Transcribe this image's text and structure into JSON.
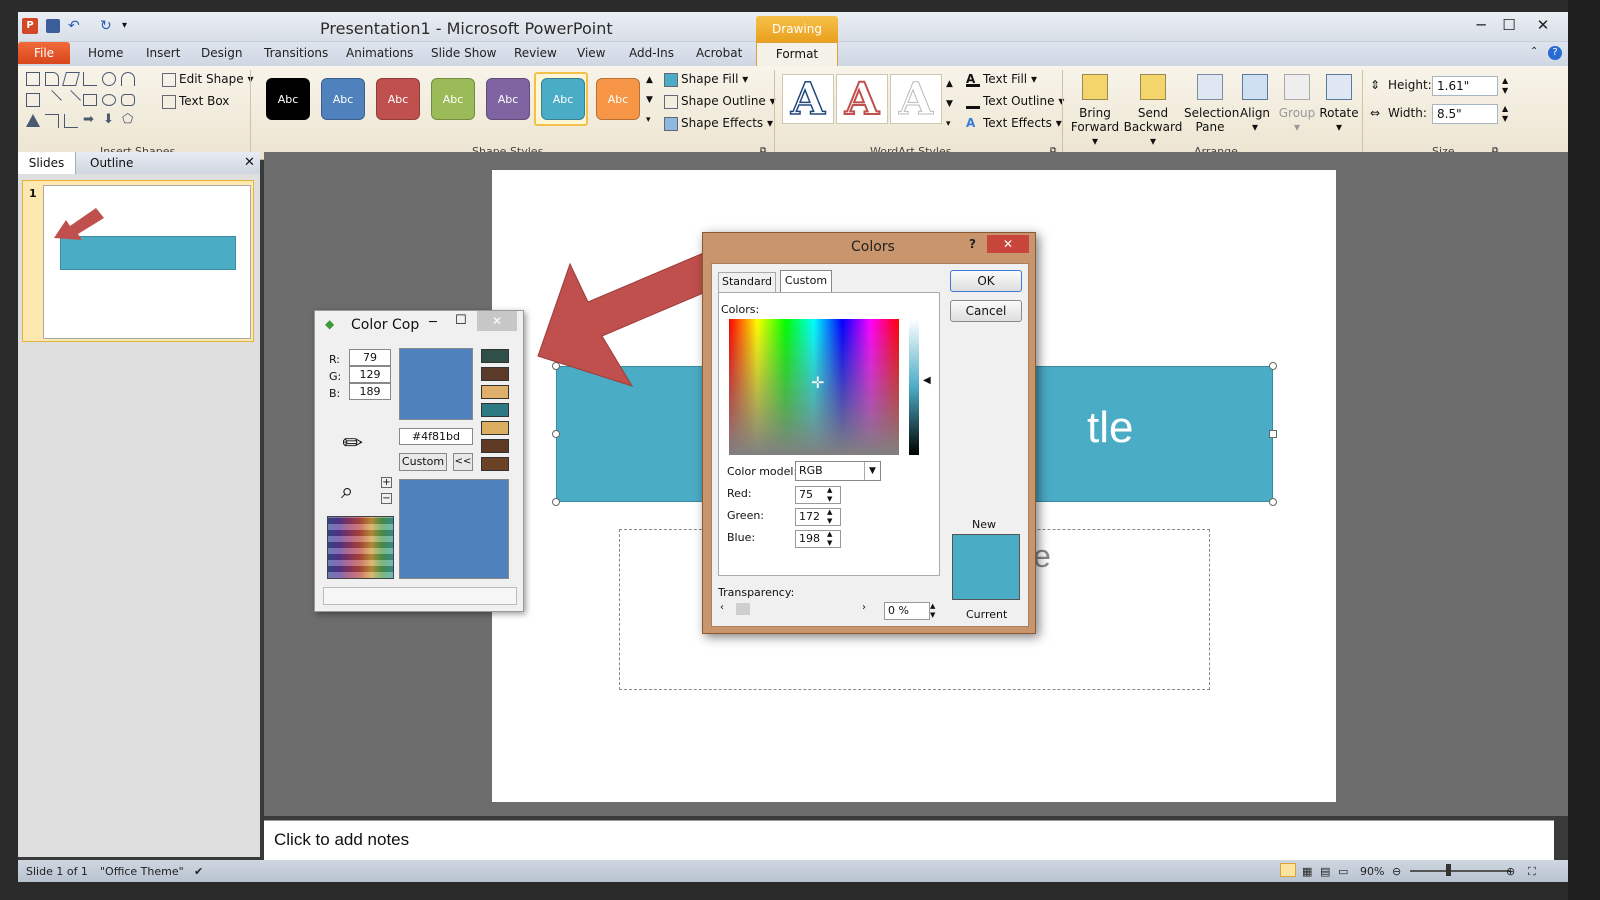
{
  "window": {
    "title": "Presentation1 - Microsoft PowerPoint",
    "contextual_tab": "Drawing Tools"
  },
  "tabs": [
    "Home",
    "Insert",
    "Design",
    "Transitions",
    "Animations",
    "Slide Show",
    "Review",
    "View",
    "Add-Ins",
    "Acrobat"
  ],
  "file_tab": "File",
  "format_tab": "Format",
  "ribbon": {
    "insert_shapes": {
      "label": "Insert Shapes",
      "edit_shape": "Edit Shape",
      "text_box": "Text Box"
    },
    "shape_styles": {
      "label": "Shape Styles",
      "swatch_text": "Abc",
      "shape_fill": "Shape Fill",
      "shape_outline": "Shape Outline",
      "shape_effects": "Shape Effects",
      "swatches": [
        "#000000",
        "#4f81bd",
        "#c0504d",
        "#9bbb59",
        "#8064a2",
        "#4bacc6",
        "#f79646"
      ]
    },
    "wordart_styles": {
      "label": "WordArt Styles",
      "glyph": "A",
      "text_fill": "Text Fill",
      "text_outline": "Text Outline",
      "text_effects": "Text Effects"
    },
    "arrange": {
      "label": "Arrange",
      "bring_forward_1": "Bring",
      "bring_forward_2": "Forward",
      "send_backward_1": "Send",
      "send_backward_2": "Backward",
      "selection_pane_1": "Selection",
      "selection_pane_2": "Pane",
      "align": "Align",
      "group": "Group",
      "rotate": "Rotate"
    },
    "size": {
      "label": "Size",
      "height_label": "Height:",
      "height": "1.61\"",
      "width_label": "Width:",
      "width": "8.5\""
    }
  },
  "slides_panel": {
    "tab_slides": "Slides",
    "tab_outline": "Outline",
    "slide_number": "1"
  },
  "slide": {
    "title_fragment": "tle",
    "subtitle_fragment": "le"
  },
  "notes": {
    "placeholder": "Click to add notes"
  },
  "status": {
    "slide": "Slide 1 of 1",
    "theme": "\"Office Theme\"",
    "zoom": "90%"
  },
  "color_cop": {
    "title": "Color Cop",
    "r_label": "R:",
    "g_label": "G:",
    "b_label": "B:",
    "r": "79",
    "g": "129",
    "b": "189",
    "hex": "#4f81bd",
    "custom_button": "Custom",
    "back_button": "<<",
    "zoom_plus": "+",
    "zoom_minus": "−",
    "color": "#4f81bd",
    "history": [
      "#2f4f47",
      "#5b3a29",
      "#e0b06a",
      "#2e7a83",
      "#dcae62",
      "#5e3a24",
      "#6b4226"
    ]
  },
  "colors_dialog": {
    "title": "Colors",
    "help": "?",
    "tab_standard": "Standard",
    "tab_custom": "Custom",
    "colors_label": "Colors:",
    "color_model_label": "Color model:",
    "color_model": "RGB",
    "red_label": "Red:",
    "green_label": "Green:",
    "blue_label": "Blue:",
    "red": "75",
    "green": "172",
    "blue": "198",
    "transparency_label": "Transparency:",
    "transparency": "0 %",
    "ok": "OK",
    "cancel": "Cancel",
    "new_label": "New",
    "current_label": "Current",
    "new_color": "#4bacc6"
  },
  "accent": {
    "shape_fill": "#4bacc6",
    "arrow": "#c0504d"
  }
}
